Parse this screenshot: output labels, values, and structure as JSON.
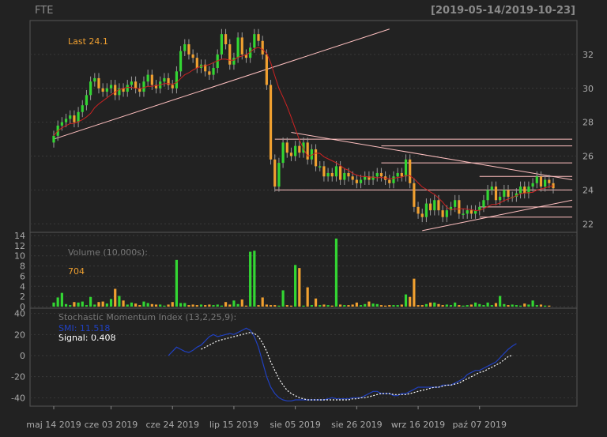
{
  "header": {
    "symbol": "FTE",
    "date_range": "[2019-05-14/2019-10-23]"
  },
  "price_panel": {
    "last_label": "Last 24.1",
    "y_ticks": [
      "22",
      "24",
      "26",
      "28",
      "30",
      "32"
    ]
  },
  "volume_panel": {
    "title": "Volume (10,000s):",
    "last_value": "704",
    "y_ticks": [
      "0",
      "2",
      "4",
      "6",
      "8",
      "10",
      "12",
      "14"
    ]
  },
  "smi_panel": {
    "title": "Stochastic Momentum Index (13,2,25,9):",
    "smi_label": "SMI: 11.518",
    "signal_label": "Signal: 0.408",
    "y_ticks": [
      "-40",
      "-20",
      "0",
      "20",
      "40"
    ]
  },
  "x_axis": {
    "labels": [
      "maj 14 2019",
      "cze 03 2019",
      "cze 24 2019",
      "lip 15 2019",
      "sie 05 2019",
      "sie 26 2019",
      "wrz 16 2019",
      "paź 07 2019"
    ]
  },
  "colors": {
    "background": "#222222",
    "up": "#33d633",
    "down": "#f0a030",
    "smi": "#2040c0",
    "signal": "#ffffff",
    "ma": "#cc2222",
    "trendline": "#ffc0c0",
    "label": "#f0a030"
  },
  "chart_data": {
    "type": "candlestick",
    "ohlc_close": [
      27.2,
      27.8,
      28.0,
      28.2,
      28.4,
      28.0,
      28.6,
      29.0,
      29.6,
      30.4,
      30.6,
      30.0,
      29.8,
      30.0,
      30.2,
      29.6,
      30.0,
      29.8,
      30.2,
      30.4,
      30.0,
      29.8,
      30.4,
      30.8,
      30.2,
      30.0,
      30.4,
      30.6,
      30.2,
      30.0,
      31.0,
      32.2,
      32.6,
      32.0,
      31.8,
      31.2,
      31.4,
      31.0,
      30.8,
      31.2,
      32.0,
      33.2,
      32.6,
      31.4,
      31.8,
      33.0,
      32.0,
      31.8,
      32.4,
      33.2,
      32.8,
      32.0,
      30.2,
      25.8,
      24.2,
      25.6,
      26.8,
      26.2,
      26.0,
      26.6,
      26.2,
      26.8,
      25.8,
      26.4,
      25.4,
      25.4,
      24.8,
      25.0,
      24.8,
      25.4,
      24.6,
      25.0,
      24.8,
      24.6,
      24.4,
      24.6,
      24.8,
      24.6,
      24.8,
      25.0,
      24.8,
      24.6,
      24.4,
      24.8,
      25.0,
      24.8,
      25.8,
      24.4,
      23.0,
      22.6,
      22.4,
      23.2,
      22.8,
      23.4,
      22.8,
      22.4,
      22.8,
      23.0,
      23.4,
      22.6,
      22.6,
      22.8,
      22.6,
      22.8,
      23.0,
      23.4,
      24.0,
      24.2,
      23.4,
      23.6,
      24.0,
      23.6,
      23.6,
      23.8,
      24.2,
      23.8,
      24.2,
      24.4,
      24.8,
      24.2,
      24.6,
      24.4,
      24.1
    ],
    "series": [
      {
        "name": "Volume (10,000s)",
        "values": [
          0.8,
          1.8,
          2.7,
          0.5,
          0.3,
          0.9,
          0.8,
          1.0,
          0.3,
          1.9,
          0.4,
          0.9,
          1.0,
          0.6,
          1.5,
          3.5,
          2.1,
          1.2,
          0.4,
          0.8,
          0.6,
          0.3,
          1.0,
          0.7,
          0.5,
          0.4,
          0.4,
          0.2,
          0.4,
          0.9,
          9.2,
          0.7,
          0.7,
          0.3,
          0.4,
          0.3,
          0.4,
          0.3,
          0.4,
          0.3,
          0.4,
          0.2,
          0.9,
          0.4,
          1.2,
          0.5,
          1.4,
          0.2,
          10.8,
          11.0,
          0.3,
          1.8,
          0.4,
          0.3,
          0.3,
          0.2,
          3.2,
          0.3,
          0.2,
          8.2,
          7.6,
          0.2,
          3.8,
          0.3,
          1.6,
          0.3,
          0.4,
          0.3,
          0.2,
          13.4,
          0.4,
          0.3,
          0.3,
          0.4,
          0.8,
          0.3,
          0.5,
          1.0,
          0.6,
          0.5,
          0.3,
          0.2,
          0.3,
          0.3,
          0.3,
          0.4,
          2.4,
          1.9,
          5.5,
          0.3,
          0.3,
          0.5,
          0.8,
          0.8,
          0.5,
          0.3,
          0.4,
          0.3,
          0.8,
          0.3,
          0.2,
          0.3,
          0.4,
          0.8,
          0.5,
          0.3,
          0.8,
          0.3,
          0.7,
          2.1,
          0.5,
          0.3,
          0.4,
          0.3,
          0.2,
          0.6,
          0.4,
          1.2,
          0.3,
          0.4,
          0.2,
          0.2
        ]
      },
      {
        "name": "SMI",
        "values": [
          null,
          null,
          null,
          null,
          null,
          null,
          null,
          null,
          null,
          null,
          null,
          null,
          null,
          null,
          null,
          null,
          null,
          null,
          null,
          null,
          null,
          null,
          null,
          null,
          null,
          null,
          null,
          null,
          0,
          4,
          8,
          6,
          4,
          3,
          5,
          8,
          10,
          14,
          18,
          20,
          18,
          19,
          20,
          21,
          20,
          22,
          24,
          26,
          24,
          18,
          8,
          -6,
          -20,
          -30,
          -36,
          -40,
          -42,
          -43,
          -43,
          -42,
          -42,
          -42,
          -42,
          -42,
          -42,
          -42,
          -42,
          -41,
          -40,
          -41,
          -41,
          -41,
          -41,
          -40,
          -40,
          -40,
          -38,
          -36,
          -34,
          -34,
          -36,
          -36,
          -36,
          -38,
          -38,
          -36,
          -36,
          -34,
          -32,
          -30,
          -30,
          -30,
          -30,
          -30,
          -30,
          -28,
          -28,
          -28,
          -26,
          -24,
          -22,
          -18,
          -16,
          -14,
          -14,
          -12,
          -10,
          -8,
          -6,
          -2,
          2,
          6,
          9,
          11.5
        ]
      },
      {
        "name": "Signal",
        "values": [
          null,
          null,
          null,
          null,
          null,
          null,
          null,
          null,
          null,
          null,
          null,
          null,
          null,
          null,
          null,
          null,
          null,
          null,
          null,
          null,
          null,
          null,
          null,
          null,
          null,
          null,
          null,
          null,
          null,
          null,
          null,
          null,
          null,
          null,
          null,
          null,
          6,
          8,
          10,
          12,
          14,
          15,
          16,
          17,
          18,
          19,
          20,
          21,
          22,
          21,
          18,
          12,
          4,
          -6,
          -14,
          -22,
          -28,
          -33,
          -36,
          -38,
          -40,
          -41,
          -42,
          -42,
          -42,
          -42,
          -42,
          -42,
          -42,
          -42,
          -42,
          -42,
          -42,
          -41,
          -41,
          -40,
          -40,
          -39,
          -38,
          -37,
          -36,
          -36,
          -36,
          -37,
          -37,
          -37,
          -37,
          -36,
          -35,
          -34,
          -33,
          -32,
          -31,
          -30,
          -30,
          -29,
          -28,
          -28,
          -27,
          -26,
          -24,
          -22,
          -20,
          -18,
          -16,
          -15,
          -13,
          -11,
          -9,
          -7,
          -4,
          -1,
          0.4
        ]
      }
    ],
    "price_ylim": [
      21.5,
      34.0
    ],
    "volume_ylim": [
      0,
      14
    ],
    "smi_ylim": [
      -48,
      45
    ]
  }
}
